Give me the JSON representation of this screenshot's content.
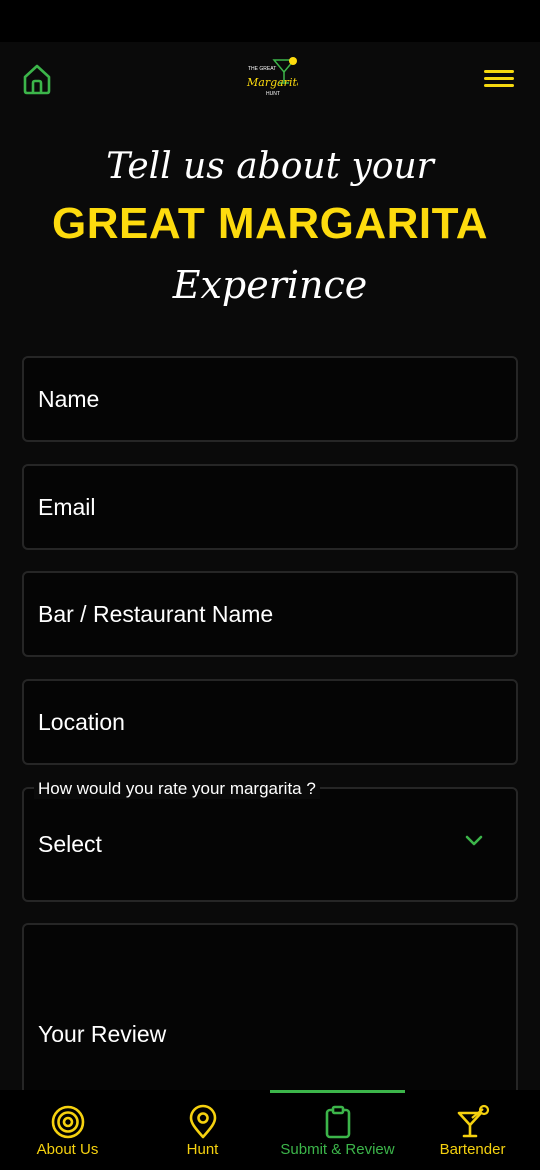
{
  "header": {
    "logo_text_top": "THE GREAT",
    "logo_text_main": "Margarita",
    "logo_text_bottom": "HUNT"
  },
  "hero": {
    "line1": "Tell us about your",
    "line2": "GREAT MARGARITA",
    "line3": "Experince"
  },
  "form": {
    "name_placeholder": "Name",
    "email_placeholder": "Email",
    "bar_placeholder": "Bar / Restaurant Name",
    "location_placeholder": "Location",
    "rating_label": "How would you rate your margarita ?",
    "rating_value": "Select",
    "review_placeholder": "Your Review"
  },
  "bottom_nav": {
    "items": [
      {
        "label": "About Us"
      },
      {
        "label": "Hunt"
      },
      {
        "label": "Submit & Review"
      },
      {
        "label": "Bartender"
      }
    ],
    "active_index": 2
  },
  "colors": {
    "accent_yellow": "#fddb0e",
    "accent_green": "#3cb54a",
    "background": "#0a0a0a"
  }
}
